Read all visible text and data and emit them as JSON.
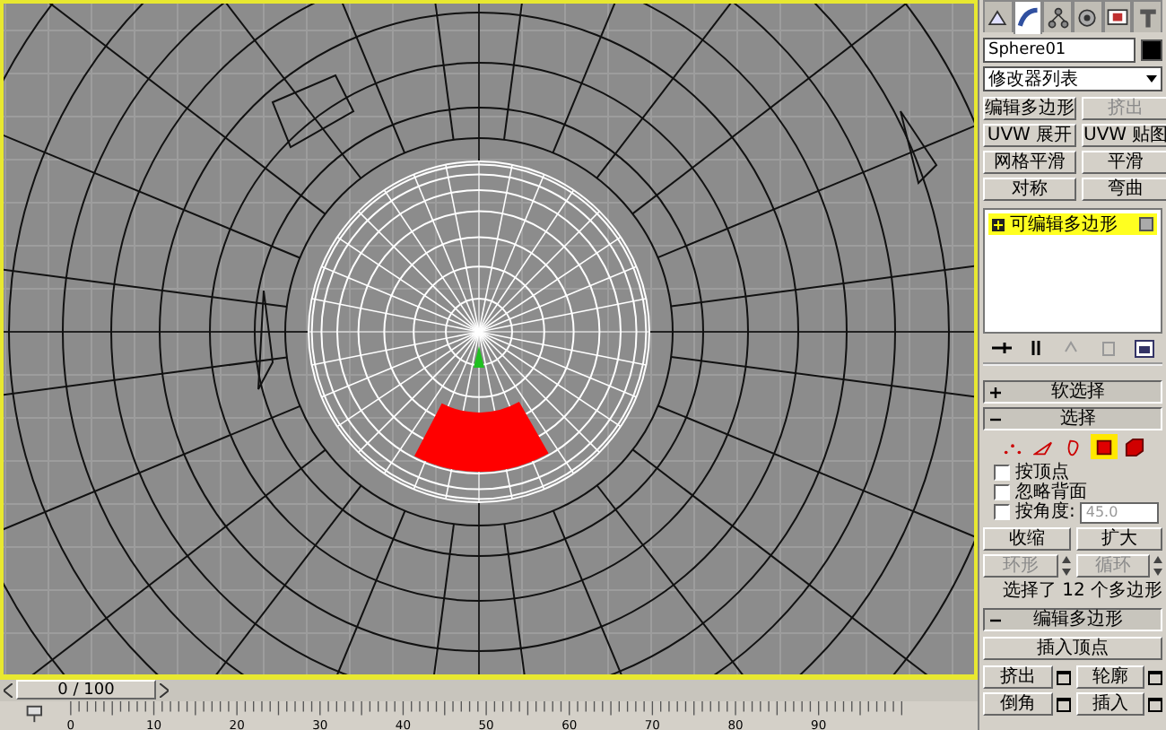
{
  "command_panel": {
    "tabs": [
      {
        "kind": "create",
        "selected": false
      },
      {
        "kind": "modify",
        "selected": true
      },
      {
        "kind": "hierarchy",
        "selected": false
      },
      {
        "kind": "motion",
        "selected": false
      },
      {
        "kind": "display",
        "selected": false
      },
      {
        "kind": "utilities",
        "selected": false
      }
    ],
    "object_name": "Sphere01",
    "modifier_list": {
      "value": "修改器列表"
    },
    "modifier_buttons": [
      {
        "label": "编辑多边形",
        "disabled": false
      },
      {
        "label": "挤出",
        "disabled": true
      },
      {
        "label": "UVW 展开",
        "disabled": false
      },
      {
        "label": "UVW 贴图",
        "disabled": false
      },
      {
        "label": "网格平滑",
        "disabled": false
      },
      {
        "label": "平滑",
        "disabled": false
      },
      {
        "label": "对称",
        "disabled": false
      },
      {
        "label": "弯曲",
        "disabled": false
      }
    ],
    "modifier_stack": [
      {
        "label": "可编辑多边形",
        "selected": true
      }
    ],
    "rollouts": [
      {
        "kind": "soft_selection",
        "title": "软选择",
        "expanded": false
      },
      {
        "kind": "selection",
        "title": "选择",
        "expanded": true
      },
      {
        "kind": "edit_polygons",
        "title": "编辑多边形",
        "expanded": true
      }
    ],
    "selection": {
      "levels": [
        {
          "kind": "vertex",
          "selected": false
        },
        {
          "kind": "edge",
          "selected": false
        },
        {
          "kind": "border",
          "selected": false
        },
        {
          "kind": "polygon",
          "selected": true
        },
        {
          "kind": "element",
          "selected": false
        }
      ],
      "checkboxes": [
        {
          "label": "按顶点",
          "checked": false
        },
        {
          "label": "忽略背面",
          "checked": false
        },
        {
          "label": "按角度:",
          "checked": false
        }
      ],
      "angle_value": {
        "value": "45.0",
        "disabled": true
      },
      "buttons": [
        {
          "label": "收缩",
          "disabled": false,
          "kind": "plain"
        },
        {
          "label": "扩大",
          "disabled": false,
          "kind": "plain"
        },
        {
          "label": "环形",
          "disabled": true,
          "kind": "spinner"
        },
        {
          "label": "循环",
          "disabled": true,
          "kind": "spinner"
        }
      ],
      "status": "选择了 12 个多边形"
    },
    "edit_polygons": {
      "insert_vertex": "插入顶点",
      "tools": [
        {
          "label": "挤出"
        },
        {
          "label": "轮廓"
        },
        {
          "label": "倒角"
        },
        {
          "label": "插入"
        }
      ]
    }
  },
  "timeline": {
    "slider_text": "0 / 100",
    "level": 0,
    "ticks": [
      "0",
      "10",
      "20",
      "30",
      "40",
      "50",
      "60",
      "70",
      "80",
      "90"
    ]
  }
}
